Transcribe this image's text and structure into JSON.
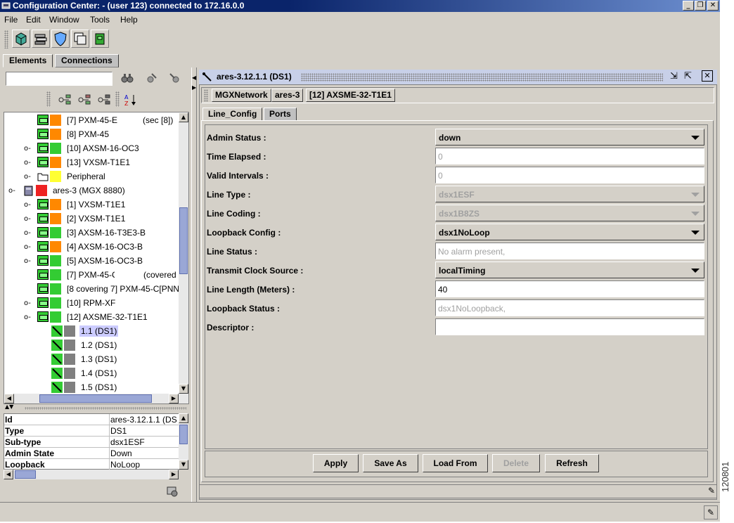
{
  "window": {
    "title": "Configuration Center: - (user 123) connected to 172.16.0.0"
  },
  "menu": {
    "file": "File",
    "edit": "Edit",
    "window": "Window",
    "tools": "Tools",
    "help": "Help"
  },
  "main_tabs": {
    "elements": "Elements",
    "connections": "Connections"
  },
  "tree": {
    "items": [
      {
        "label": "[7] PXM-45-E",
        "extra": "(sec [8])"
      },
      {
        "label": "[8] PXM-45",
        "extra": ""
      },
      {
        "label": "[10] AXSM-16-OC3",
        "extra": ""
      },
      {
        "label": "[13] VXSM-T1E1",
        "extra": ""
      },
      {
        "label": "Peripheral",
        "extra": ""
      },
      {
        "label": "ares-3 (MGX 8880)",
        "extra": ""
      },
      {
        "label": "[1] VXSM-T1E1",
        "extra": ""
      },
      {
        "label": "[2] VXSM-T1E1",
        "extra": ""
      },
      {
        "label": "[3] AXSM-16-T3E3-B",
        "extra": ""
      },
      {
        "label": "[4] AXSM-16-OC3-B",
        "extra": ""
      },
      {
        "label": "[5] AXSM-16-OC3-B",
        "extra": ""
      },
      {
        "label": "[7] PXM-45-C",
        "extra": "(covered"
      },
      {
        "label": "[8 covering 7] PXM-45-C[PNN",
        "extra": ""
      },
      {
        "label": "[10] RPM-XF",
        "extra": ""
      },
      {
        "label": "[12] AXSME-32-T1E1",
        "extra": ""
      },
      {
        "label": "1.1  (DS1)",
        "extra": ""
      },
      {
        "label": "1.2  (DS1)",
        "extra": ""
      },
      {
        "label": "1.3  (DS1)",
        "extra": ""
      },
      {
        "label": "1.4  (DS1)",
        "extra": ""
      },
      {
        "label": "1.5  (DS1)",
        "extra": ""
      }
    ]
  },
  "properties": {
    "rows": [
      {
        "key": "Id",
        "value": "ares-3.12.1.1  (DS"
      },
      {
        "key": "Type",
        "value": "DS1"
      },
      {
        "key": "Sub-type",
        "value": "dsx1ESF"
      },
      {
        "key": "Admin State",
        "value": "Down"
      },
      {
        "key": "Loopback",
        "value": "NoLoop"
      }
    ]
  },
  "detail": {
    "title": "ares-3.12.1.1  (DS1)",
    "breadcrumb": [
      "MGXNetwork",
      "ares-3",
      "[12] AXSME-32-T1E1"
    ],
    "tabs": {
      "line_config": "Line_Config",
      "ports": "Ports"
    },
    "fields": {
      "admin_status": {
        "label": "Admin Status :",
        "value": "down"
      },
      "time_elapsed": {
        "label": "Time Elapsed :",
        "value": "0"
      },
      "valid_intervals": {
        "label": "Valid Intervals :",
        "value": "0"
      },
      "line_type": {
        "label": "Line Type :",
        "value": "dsx1ESF"
      },
      "line_coding": {
        "label": "Line Coding :",
        "value": "dsx1B8ZS"
      },
      "loopback_config": {
        "label": "Loopback Config :",
        "value": "dsx1NoLoop"
      },
      "line_status": {
        "label": "Line Status :",
        "value": "No alarm present,"
      },
      "transmit_clock_source": {
        "label": "Transmit Clock Source :",
        "value": "localTiming"
      },
      "line_length": {
        "label": "Line Length (Meters) :",
        "value": "40"
      },
      "loopback_status": {
        "label": "Loopback Status :",
        "value": "dsx1NoLoopback,"
      },
      "descriptor": {
        "label": "Descriptor :",
        "value": ""
      }
    },
    "buttons": {
      "apply": "Apply",
      "save_as": "Save As",
      "load_from": "Load From",
      "delete": "Delete",
      "refresh": "Refresh"
    }
  },
  "figure_id": "120801",
  "colors": {
    "title_bar": "#0a246a",
    "panel": "#d4d0c8",
    "status_green": "#33cc33",
    "status_orange": "#ff8800",
    "status_red": "#ee2222",
    "status_yellow": "#ffff33",
    "status_gray": "#808080",
    "selection": "#ccccff"
  }
}
